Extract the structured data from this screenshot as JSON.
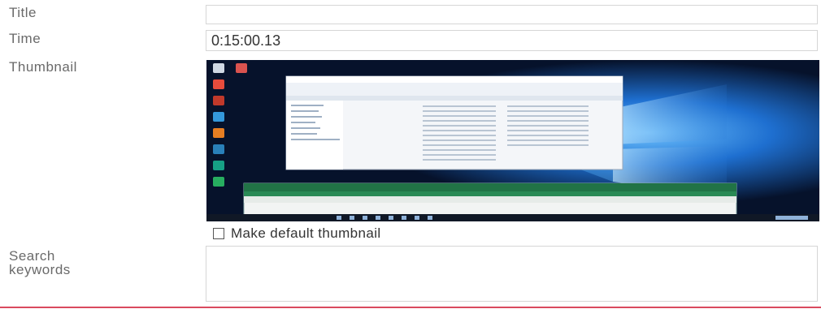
{
  "form": {
    "title_label": "Title",
    "title_value": "",
    "time_label": "Time",
    "time_value": "0:15:00.13",
    "thumbnail_label": "Thumbnail",
    "default_thumb_label": "Make default thumbnail",
    "default_thumb_checked": false,
    "search_label": "Search keywords",
    "search_value": ""
  },
  "colors": {
    "accent_line": "#d9495e",
    "border": "#d6d6d6"
  }
}
